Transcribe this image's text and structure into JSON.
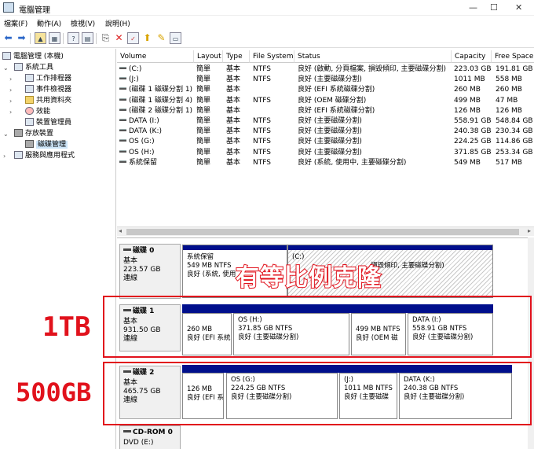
{
  "window": {
    "title": "電腦管理"
  },
  "menu": [
    "檔案(F)",
    "動作(A)",
    "檢視(V)",
    "說明(H)"
  ],
  "toolbar_icons": [
    "back-arrow-icon",
    "forward-arrow-icon",
    "folder-up-icon",
    "console-tree-icon",
    "help-icon",
    "properties-icon",
    "connect-icon",
    "delete-icon",
    "check-icon",
    "export-icon",
    "help-topic-icon",
    "view-icon"
  ],
  "tree": {
    "root": "電腦管理 (本機)",
    "system_tools": "系統工具",
    "task_scheduler": "工作排程器",
    "event_viewer": "事件檢視器",
    "shared_folders": "共用資料夾",
    "performance": "效能",
    "device_manager": "裝置管理員",
    "storage": "存放裝置",
    "disk_management": "磁碟管理",
    "services": "服務與應用程式"
  },
  "columns": [
    "Volume",
    "Layout",
    "Type",
    "File System",
    "Status",
    "Capacity",
    "Free Space"
  ],
  "volumes": [
    [
      "(C:)",
      "簡單",
      "基本",
      "NTFS",
      "良好 (啟動, 分頁檔案, 損毀傾印, 主要磁碟分割)",
      "223.03 GB",
      "191.81 GB"
    ],
    [
      "(J:)",
      "簡單",
      "基本",
      "NTFS",
      "良好 (主要磁碟分割)",
      "1011 MB",
      "558 MB"
    ],
    [
      "(磁碟 1 磁碟分割 1)",
      "簡單",
      "基本",
      "",
      "良好 (EFI 系統磁碟分割)",
      "260 MB",
      "260 MB"
    ],
    [
      "(磁碟 1 磁碟分割 4)",
      "簡單",
      "基本",
      "NTFS",
      "良好 (OEM 磁碟分割)",
      "499 MB",
      "47 MB"
    ],
    [
      "(磁碟 2 磁碟分割 1)",
      "簡單",
      "基本",
      "",
      "良好 (EFI 系統磁碟分割)",
      "126 MB",
      "126 MB"
    ],
    [
      "DATA (I:)",
      "簡單",
      "基本",
      "NTFS",
      "良好 (主要磁碟分割)",
      "558.91 GB",
      "548.84 GB"
    ],
    [
      "DATA (K:)",
      "簡單",
      "基本",
      "NTFS",
      "良好 (主要磁碟分割)",
      "240.38 GB",
      "230.34 GB"
    ],
    [
      "OS (G:)",
      "簡單",
      "基本",
      "NTFS",
      "良好 (主要磁碟分割)",
      "224.25 GB",
      "114.86 GB"
    ],
    [
      "OS (H:)",
      "簡單",
      "基本",
      "NTFS",
      "良好 (主要磁碟分割)",
      "371.85 GB",
      "253.34 GB"
    ],
    [
      "系統保留",
      "簡單",
      "基本",
      "NTFS",
      "良好 (系統, 使用中, 主要磁碟分割)",
      "549 MB",
      "517 MB"
    ]
  ],
  "disks": [
    {
      "name": "磁碟 0",
      "type": "基本",
      "size": "223.57 GB",
      "status": "連線",
      "partitions": [
        {
          "title": "系統保留",
          "size": "549 MB NTFS",
          "status": "良好 (系統, 使用"
        },
        {
          "title": "(C:)",
          "size": "",
          "status": "損毀傾印, 主要磁碟分割)"
        }
      ]
    },
    {
      "name": "磁碟 1",
      "type": "基本",
      "size": "931.50 GB",
      "status": "連線",
      "partitions": [
        {
          "title": "",
          "size": "260 MB",
          "status": "良好 (EFI 系統"
        },
        {
          "title": "OS (H:)",
          "size": "371.85 GB NTFS",
          "status": "良好 (主要磁碟分割)"
        },
        {
          "title": "",
          "size": "499 MB NTFS",
          "status": "良好 (OEM 磁"
        },
        {
          "title": "DATA (I:)",
          "size": "558.91 GB NTFS",
          "status": "良好 (主要磁碟分割)"
        }
      ]
    },
    {
      "name": "磁碟 2",
      "type": "基本",
      "size": "465.75 GB",
      "status": "連線",
      "partitions": [
        {
          "title": "",
          "size": "126 MB",
          "status": "良好 (EFI 系"
        },
        {
          "title": "OS (G:)",
          "size": "224.25 GB NTFS",
          "status": "良好 (主要磁碟分割)"
        },
        {
          "title": "(J:)",
          "size": "1011 MB NTFS",
          "status": "良好 (主要磁碟"
        },
        {
          "title": "DATA (K:)",
          "size": "240.38 GB NTFS",
          "status": "良好 (主要磁碟分割)"
        }
      ]
    },
    {
      "name": "CD-ROM 0",
      "type": "DVD (E:)"
    }
  ],
  "annotations": {
    "headline": "有等比例克隆",
    "label_1tb": "1TB",
    "label_500gb": "500GB"
  },
  "colors": {
    "accent_red": "#e1121c",
    "partition_header": "#000f8c",
    "selection": "#cce4f7"
  }
}
